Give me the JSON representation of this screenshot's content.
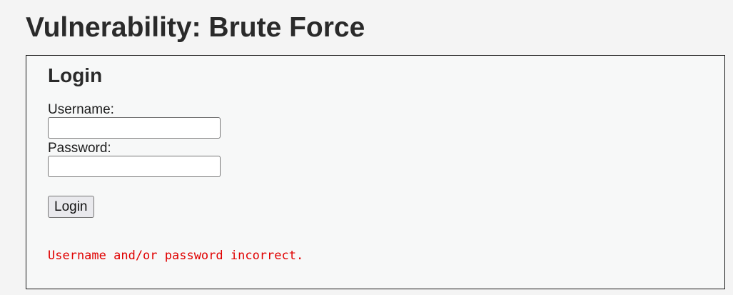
{
  "page": {
    "title": "Vulnerability: Brute Force"
  },
  "login_form": {
    "heading": "Login",
    "username_label": "Username:",
    "username_value": "",
    "password_label": "Password:",
    "password_value": "",
    "submit_label": "Login"
  },
  "message": {
    "text": "Username and/or password incorrect.",
    "color": "#e00000"
  }
}
